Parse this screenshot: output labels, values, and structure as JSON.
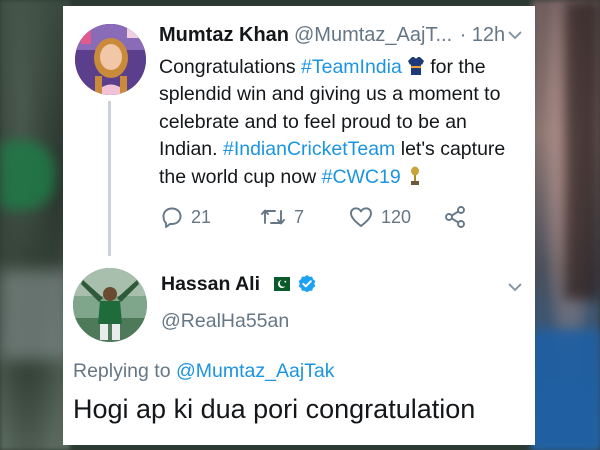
{
  "tweet1": {
    "author_name": "Mumtaz Khan",
    "author_handle": "@Mumtaz_AajT...",
    "time": "· 12h",
    "body_line1_a": "Congratulations ",
    "body_line1_hashtag": "#TeamIndia",
    "body_line1_b": "  for the",
    "body_line2": "splendid win and giving us a moment to",
    "body_line3": "celebrate and to feel proud to be an",
    "body_line4_a": "Indian. ",
    "body_line4_hashtag": "#IndianCricketTeam",
    "body_line4_b": " let's capture",
    "body_line5_a": "the world cup now ",
    "body_line5_hashtag": "#CWC19",
    "reply_count": "21",
    "retweet_count": "7",
    "like_count": "120"
  },
  "tweet2": {
    "author_name": "Hassan Ali",
    "author_handle": "@RealHa55an",
    "replying_prefix": "Replying to ",
    "replying_mention": "@Mumtaz_AajTak",
    "body": "Hogi ap ki dua pori congratulation"
  },
  "colors": {
    "link": "#1b95e0",
    "secondary_text": "#657786",
    "primary_text": "#14171a",
    "verified": "#1da1f2"
  },
  "icons": [
    "chevron-down-icon",
    "reply-icon",
    "retweet-icon",
    "like-icon",
    "share-icon",
    "jersey-emoji-icon",
    "trophy-emoji-icon",
    "pakistan-flag-icon",
    "verified-badge-icon"
  ]
}
